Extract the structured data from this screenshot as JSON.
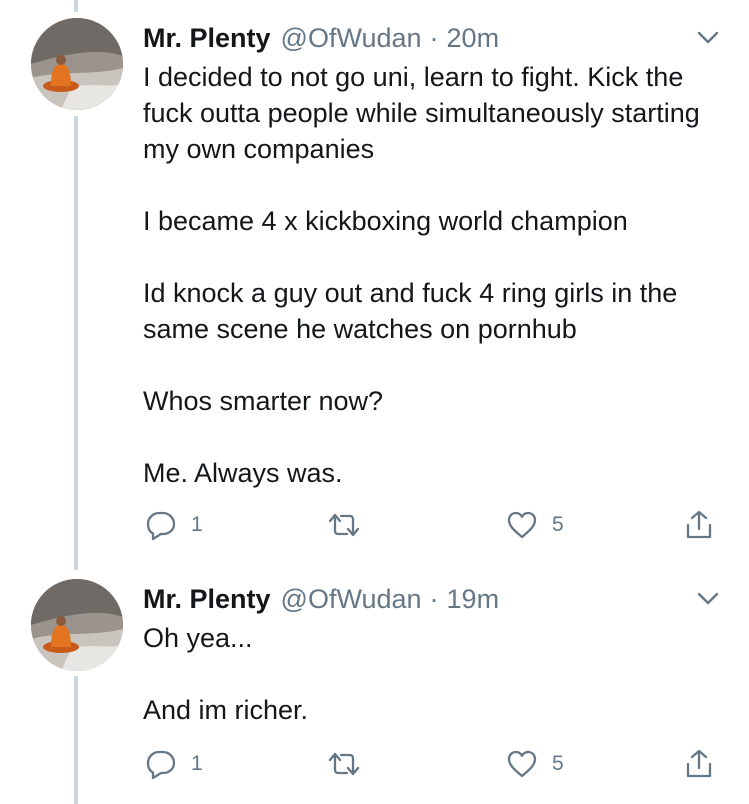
{
  "tweets": [
    {
      "display_name": "Mr. Plenty",
      "handle": "@OfWudan",
      "separator": "·",
      "time": "20m",
      "paragraphs": [
        "I decided to not go uni, learn to fight. Kick the fuck outta people while simultaneously starting my own companies",
        "I became 4 x kickboxing world champion",
        "Id knock a guy out and fuck 4 ring girls in the same scene he watches on pornhub",
        "Whos smarter now?",
        "Me. Always was."
      ],
      "reply_count": "1",
      "retweet_count": "",
      "like_count": "5",
      "icons": [
        "chevron-down-icon",
        "reply-icon",
        "retweet-icon",
        "like-icon",
        "share-icon"
      ]
    },
    {
      "display_name": "Mr. Plenty",
      "handle": "@OfWudan",
      "separator": "·",
      "time": "19m",
      "paragraphs": [
        "Oh yea...",
        "And im richer."
      ],
      "reply_count": "1",
      "retweet_count": "",
      "like_count": "5",
      "icons": [
        "chevron-down-icon",
        "reply-icon",
        "retweet-icon",
        "like-icon",
        "share-icon"
      ]
    }
  ],
  "colors": {
    "text": "#14171a",
    "secondary": "#657786",
    "thread_line": "#ccd6dd",
    "background": "#ffffff"
  }
}
